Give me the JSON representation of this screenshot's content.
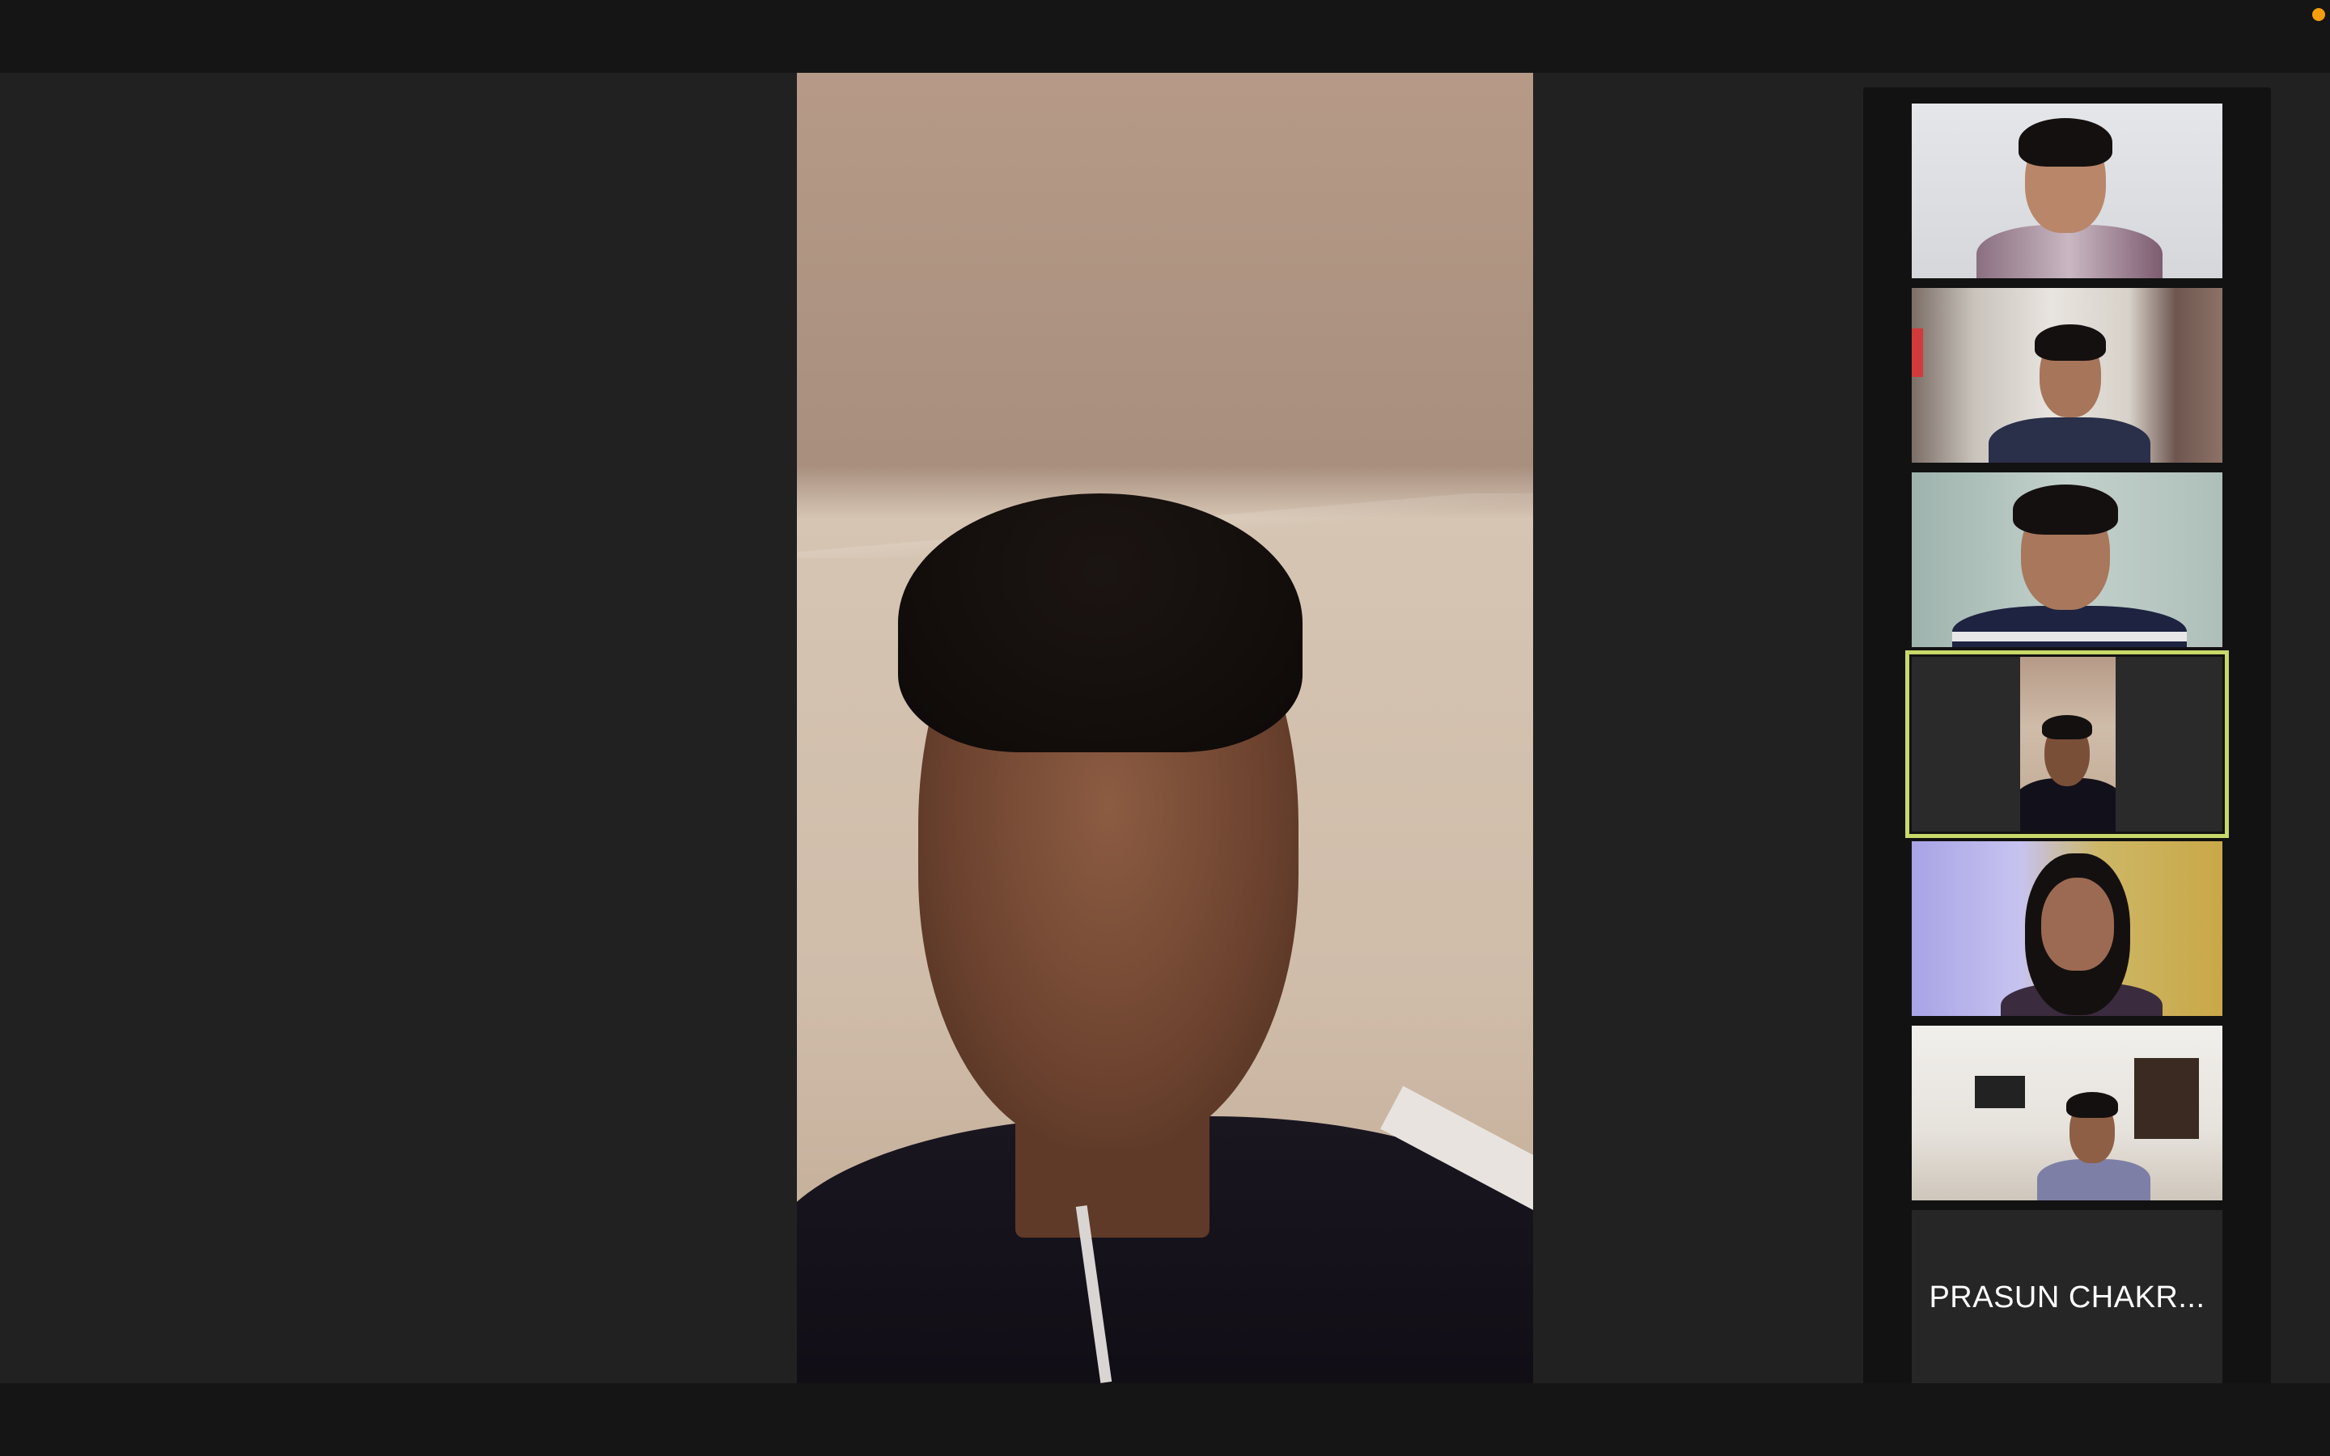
{
  "meeting": {
    "recording_indicator_color": "#f59e0b",
    "active_speaker_border_color": "#c8d96a"
  },
  "main_video": {
    "icon": "video-feed"
  },
  "gallery": {
    "participants": [
      {
        "type": "video"
      },
      {
        "type": "video"
      },
      {
        "type": "video"
      },
      {
        "type": "video",
        "active_speaker": true
      },
      {
        "type": "video"
      },
      {
        "type": "video"
      },
      {
        "type": "name",
        "name": "PRASUN CHAKR..."
      }
    ]
  }
}
